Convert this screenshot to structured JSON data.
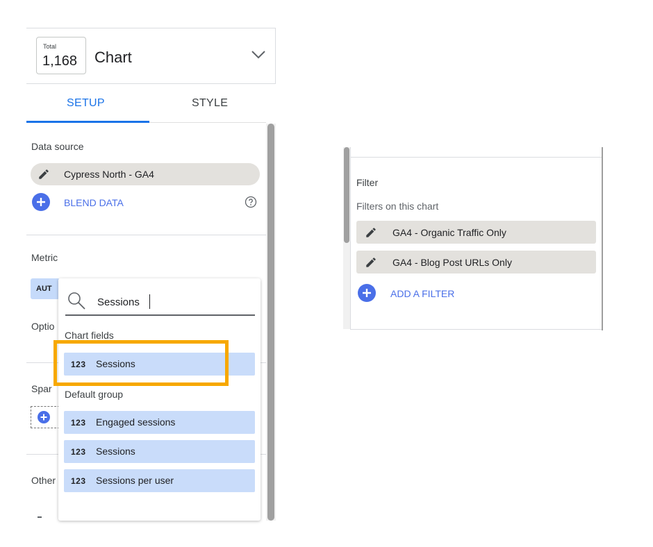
{
  "header": {
    "chart_icon_small": "Total",
    "chart_icon_value": "1,168",
    "title": "Chart",
    "dropdown_icon": "chevron-down-icon"
  },
  "tabs": [
    {
      "label": "SETUP",
      "active": true
    },
    {
      "label": "STYLE",
      "active": false
    }
  ],
  "data_source": {
    "label": "Data source",
    "name": "Cypress North - GA4",
    "blend_label": "BLEND DATA"
  },
  "metric": {
    "label": "Metric",
    "chip_text": "AUT"
  },
  "sections": {
    "options_partial": "Optio",
    "sparkline_partial": "Spar",
    "other_partial": "Other"
  },
  "dropdown": {
    "search_value": "Sessions",
    "groups": [
      {
        "label": "Chart fields",
        "fields": [
          {
            "type": "123",
            "name": "Sessions"
          }
        ]
      },
      {
        "label": "Default group",
        "fields": [
          {
            "type": "123",
            "name": "Engaged sessions"
          },
          {
            "type": "123",
            "name": "Sessions"
          },
          {
            "type": "123",
            "name": "Sessions per user"
          }
        ]
      }
    ]
  },
  "filter_panel": {
    "title": "Filter",
    "subtitle": "Filters on this chart",
    "filters": [
      "GA4 - Organic Traffic Only",
      "GA4 - Blog Post URLs Only"
    ],
    "add_label": "ADD A FILTER"
  },
  "colors": {
    "accent_blue": "#1a73e8",
    "add_blue": "#4a6fe8",
    "highlight_orange": "#f7a800",
    "field_chip": "#c9dcfa",
    "chip_gray": "#e3e1dd"
  }
}
